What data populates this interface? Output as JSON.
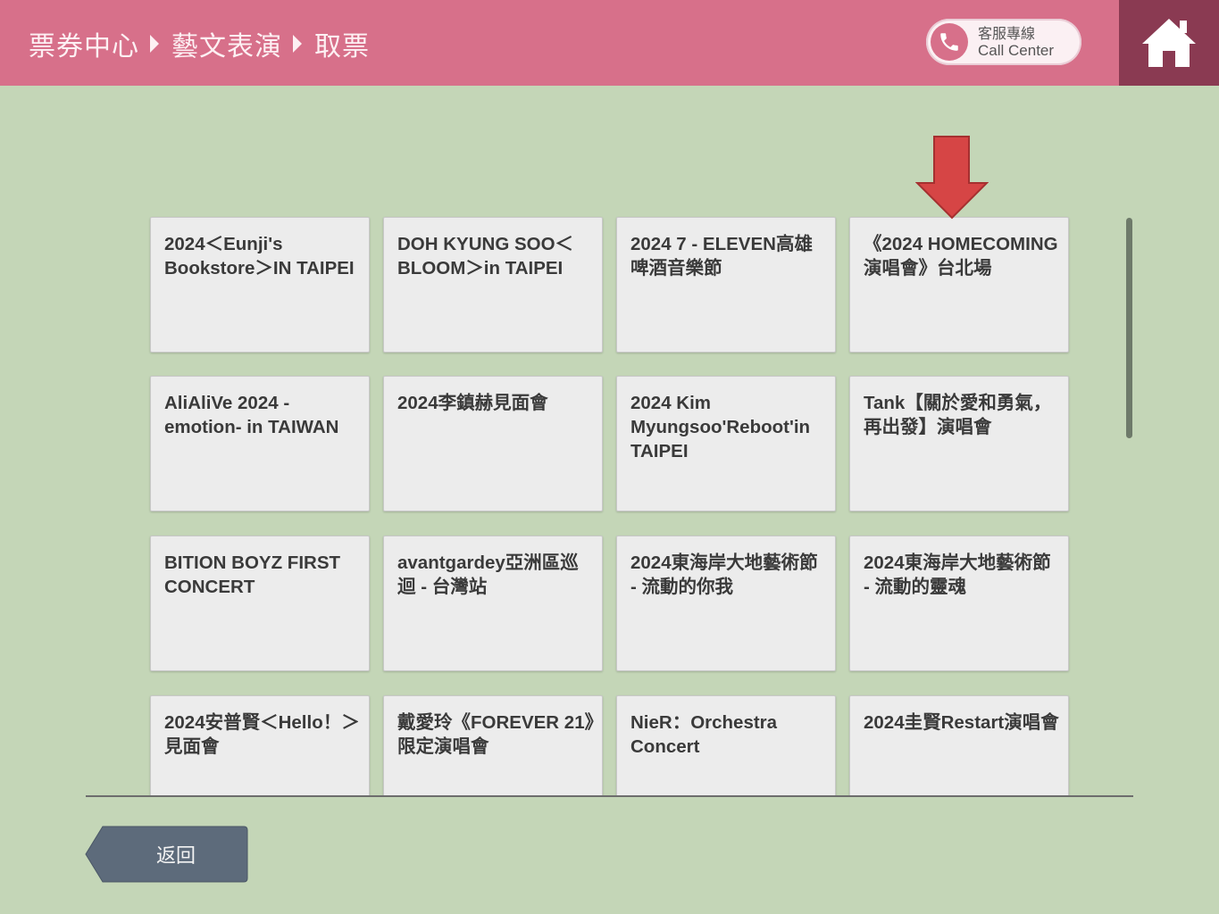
{
  "header": {
    "breadcrumb": [
      "票券中心",
      "藝文表演",
      "取票"
    ],
    "call_center": {
      "label_zh": "客服專線",
      "label_en": "Call Center",
      "icon": "phone-icon"
    },
    "home_icon": "home-icon",
    "color": "#d7708a",
    "home_color": "#8a3a52"
  },
  "events": [
    "2024＜Eunji's Bookstore＞IN TAIPEI",
    "DOH KYUNG SOO＜BLOOM＞in TAIPEI",
    "2024 7 - ELEVEN高雄啤酒音樂節",
    "《2024 HOMECOMING 演唱會》台北場",
    "AliAliVe 2024 -emotion- in TAIWAN",
    "2024李鎮赫見面會",
    "2024 Kim Myungsoo'Reboot'in TAIPEI",
    "Tank【關於愛和勇氣，再出發】演唱會",
    "BITION BOYZ FIRST CONCERT",
    "avantgardey亞洲區巡迴 - 台灣站",
    "2024東海岸大地藝術節 - 流動的你我",
    "2024東海岸大地藝術節 - 流動的靈魂",
    "2024安普賢＜Hello！＞見面會",
    "戴愛玲《FOREVER 21》限定演唱會",
    "NieR：Orchestra Concert",
    "2024圭賢Restart演唱會"
  ],
  "annotation": {
    "icon": "red-down-arrow",
    "color": "#d64545",
    "target": "《2024 HOMECOMING 演唱會》台北場"
  },
  "footer": {
    "back_label": "返回"
  },
  "colors": {
    "background": "#c4d6b7",
    "card": "#ececec",
    "text": "#3a3a3a"
  }
}
